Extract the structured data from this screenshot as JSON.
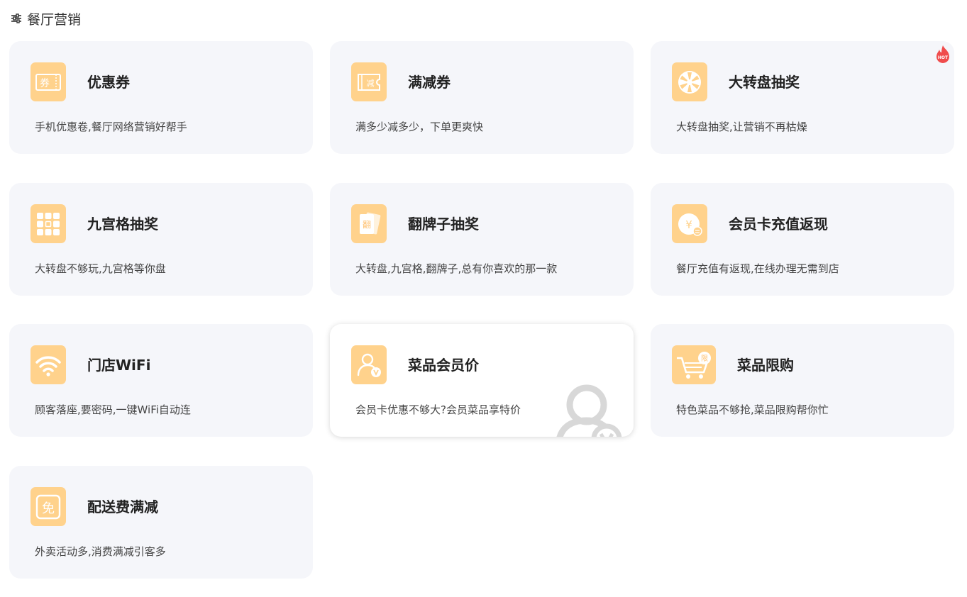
{
  "page": {
    "title": "餐厅营销",
    "filter_icon": "sliders-icon"
  },
  "colors": {
    "icon_bg": "#ffd28c",
    "card_bg": "#f5f6fa",
    "hot": "#f04c4c"
  },
  "cards": [
    {
      "name": "优惠券",
      "desc": "手机优惠卷,餐厅网络营销好帮手",
      "icon": "coupon-icon",
      "icon_text": "券"
    },
    {
      "name": "满减券",
      "desc": "满多少减多少，下单更爽快",
      "icon": "discount-ticket-icon",
      "icon_text": "减"
    },
    {
      "name": "大转盘抽奖",
      "desc": "大转盘抽奖,让营销不再枯燥",
      "icon": "wheel-icon",
      "badge": "HOT"
    },
    {
      "name": "九宫格抽奖",
      "desc": "大转盘不够玩,九宫格等你盘",
      "icon": "grid-icon"
    },
    {
      "name": "翻牌子抽奖",
      "desc": "大转盘,九宫格,翻牌子,总有你喜欢的那一款",
      "icon": "flip-card-icon",
      "icon_text": "翻"
    },
    {
      "name": "会员卡充值返现",
      "desc": "餐厅充值有返现,在线办理无需到店",
      "icon": "yen-coin-icon",
      "icon_text": "¥"
    },
    {
      "name": "门店WiFi",
      "desc": "顾客落座,要密码,一键WiFi自动连",
      "icon": "wifi-icon"
    },
    {
      "name": "菜品会员价",
      "desc": "会员卡优惠不够大?会员菜品享特价",
      "icon": "member-price-icon",
      "active": true
    },
    {
      "name": "菜品限购",
      "desc": "特色菜品不够抢,菜品限购帮你忙",
      "icon": "cart-icon",
      "icon_text": "限"
    },
    {
      "name": "配送费满减",
      "desc": "外卖活动多,消费满减引客多",
      "icon": "free-icon",
      "icon_text": "免"
    }
  ]
}
